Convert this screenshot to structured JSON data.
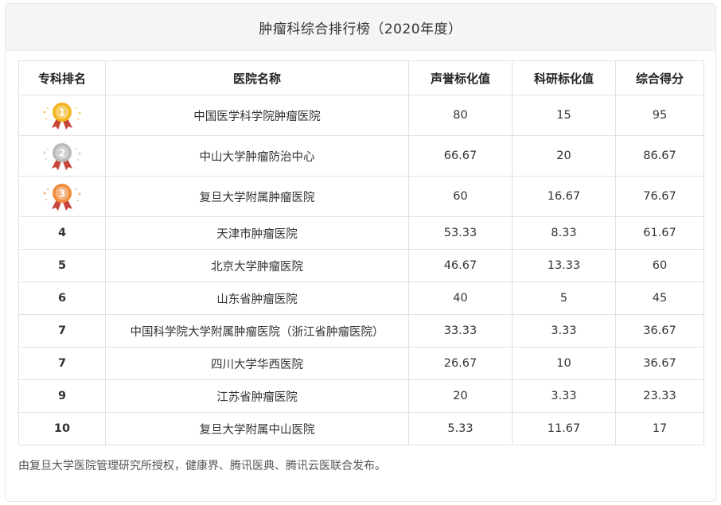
{
  "title": "肿瘤科综合排行榜（2020年度）",
  "columns": [
    "专科排名",
    "医院名称",
    "声誉标化值",
    "科研标化值",
    "综合得分"
  ],
  "rows": [
    {
      "rank": "1",
      "medal": "gold-medal-icon",
      "name": "中国医学科学院肿瘤医院",
      "reputation": "80",
      "research": "15",
      "score": "95"
    },
    {
      "rank": "2",
      "medal": "silver-medal-icon",
      "name": "中山大学肿瘤防治中心",
      "reputation": "66.67",
      "research": "20",
      "score": "86.67"
    },
    {
      "rank": "3",
      "medal": "bronze-medal-icon",
      "name": "复旦大学附属肿瘤医院",
      "reputation": "60",
      "research": "16.67",
      "score": "76.67"
    },
    {
      "rank": "4",
      "name": "天津市肿瘤医院",
      "reputation": "53.33",
      "research": "8.33",
      "score": "61.67"
    },
    {
      "rank": "5",
      "name": "北京大学肿瘤医院",
      "reputation": "46.67",
      "research": "13.33",
      "score": "60"
    },
    {
      "rank": "6",
      "name": "山东省肿瘤医院",
      "reputation": "40",
      "research": "5",
      "score": "45"
    },
    {
      "rank": "7",
      "name": "中国科学院大学附属肿瘤医院（浙江省肿瘤医院）",
      "reputation": "33.33",
      "research": "3.33",
      "score": "36.67"
    },
    {
      "rank": "7",
      "name": "四川大学华西医院",
      "reputation": "26.67",
      "research": "10",
      "score": "36.67"
    },
    {
      "rank": "9",
      "name": "江苏省肿瘤医院",
      "reputation": "20",
      "research": "3.33",
      "score": "23.33"
    },
    {
      "rank": "10",
      "name": "复旦大学附属中山医院",
      "reputation": "5.33",
      "research": "11.67",
      "score": "17"
    }
  ],
  "medal_colors": {
    "gold": "#f2b51c",
    "silver": "#b9b9b9",
    "bronze": "#ef8b3a",
    "ribbon": "#c9463d"
  },
  "footer": "由复旦大学医院管理研究所授权，健康界、腾讯医典、腾讯云医联合发布。"
}
